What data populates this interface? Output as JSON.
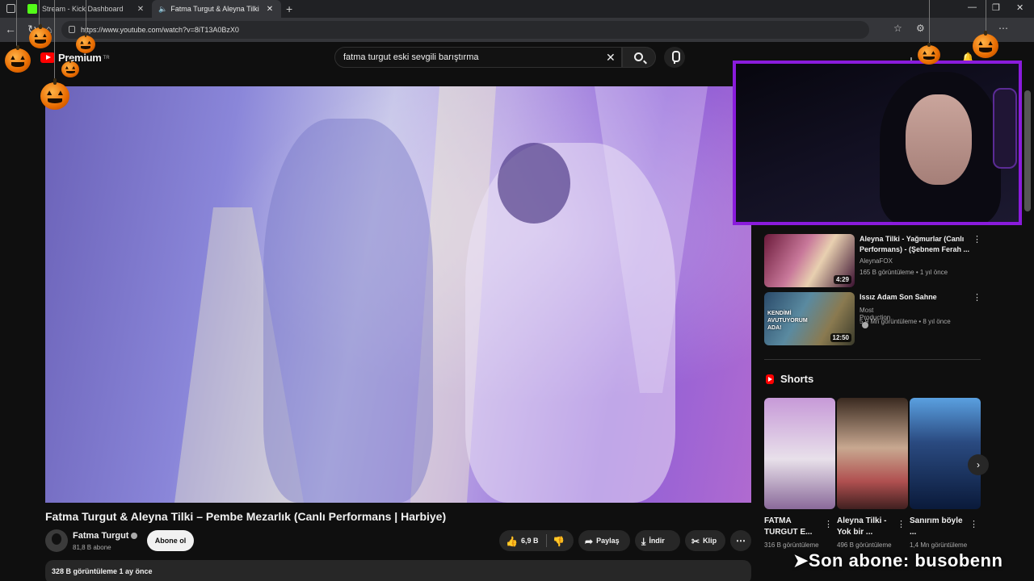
{
  "browser": {
    "tabs": [
      {
        "label": "Stream - Kick Dashboard"
      },
      {
        "label": "Fatma Turgut & Aleyna Tilki"
      }
    ],
    "url": "https://www.youtube.com/watch?v=8iT13A0BzX0"
  },
  "youtube": {
    "logo_text": "Premium",
    "logo_region": "TR",
    "search_query": "fatma turgut eski sevgili barıştırma",
    "video": {
      "title": "Fatma Turgut & Aleyna Tilki – Pembe Mezarlık (Canlı Performans | Harbiye)",
      "channel": "Fatma Turgut",
      "subscribers": "81,8 B abone",
      "subscribe_label": "Abone ol",
      "likes": "6,9 B",
      "share_label": "Paylaş",
      "download_label": "İndir",
      "clip_label": "Klip",
      "views_date": "328 B görüntüleme   1 ay önce"
    },
    "recommendations": [
      {
        "title": "Aleyna Tilki - Yağmurlar (Canlı Performans) - (Şebnem Ferah ...",
        "channel": "AleynaFOX",
        "meta": "165 B görüntüleme • 1 yıl önce",
        "duration": "4:29"
      },
      {
        "title": "Issız Adam Son Sahne",
        "channel": "Most Production",
        "meta": "5,9 Mn görüntüleme • 8 yıl önce",
        "duration": "12:50",
        "thumb_text": "KENDİMİ AVUTUYORUM ADA!"
      }
    ],
    "shorts": {
      "heading": "Shorts",
      "items": [
        {
          "title": "FATMA TURGUT E...",
          "views": "316 B görüntüleme"
        },
        {
          "title": "Aleyna Tilki - Yok bir ...",
          "views": "496 B görüntüleme"
        },
        {
          "title": "Sanırım böyle ...",
          "views": "1,4 Mn görüntüleme"
        }
      ]
    }
  },
  "stream_overlay": {
    "text": "➤Son abone: busobenn"
  },
  "colors": {
    "webcam_border": "#8a1bdc",
    "youtube_red": "#ff0000",
    "background": "#0f0f0f"
  }
}
